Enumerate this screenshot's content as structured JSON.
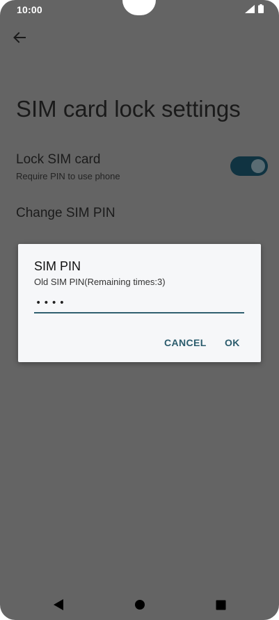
{
  "status_bar": {
    "time": "10:00",
    "icons": [
      "cell-signal-icon",
      "battery-icon"
    ]
  },
  "toolbar": {
    "back_icon": "arrow-left-icon"
  },
  "page": {
    "title": "SIM card lock settings"
  },
  "settings": {
    "lock_sim": {
      "title": "Lock SIM card",
      "summary": "Require PIN to use phone",
      "enabled": true
    },
    "change_pin": {
      "title": "Change SIM PIN"
    }
  },
  "dialog": {
    "title": "SIM PIN",
    "message": "Old SIM PIN(Remaining times:3)",
    "input_value": "••••",
    "cancel_label": "CANCEL",
    "ok_label": "OK"
  },
  "nav_bar": {
    "icons": [
      "back-triangle-icon",
      "home-circle-icon",
      "recents-square-icon"
    ]
  },
  "colors": {
    "scrim_background": "#646464",
    "toggle_track": "#103341",
    "accent": "#2b5c6d",
    "dialog_background": "#f6f7f9"
  }
}
